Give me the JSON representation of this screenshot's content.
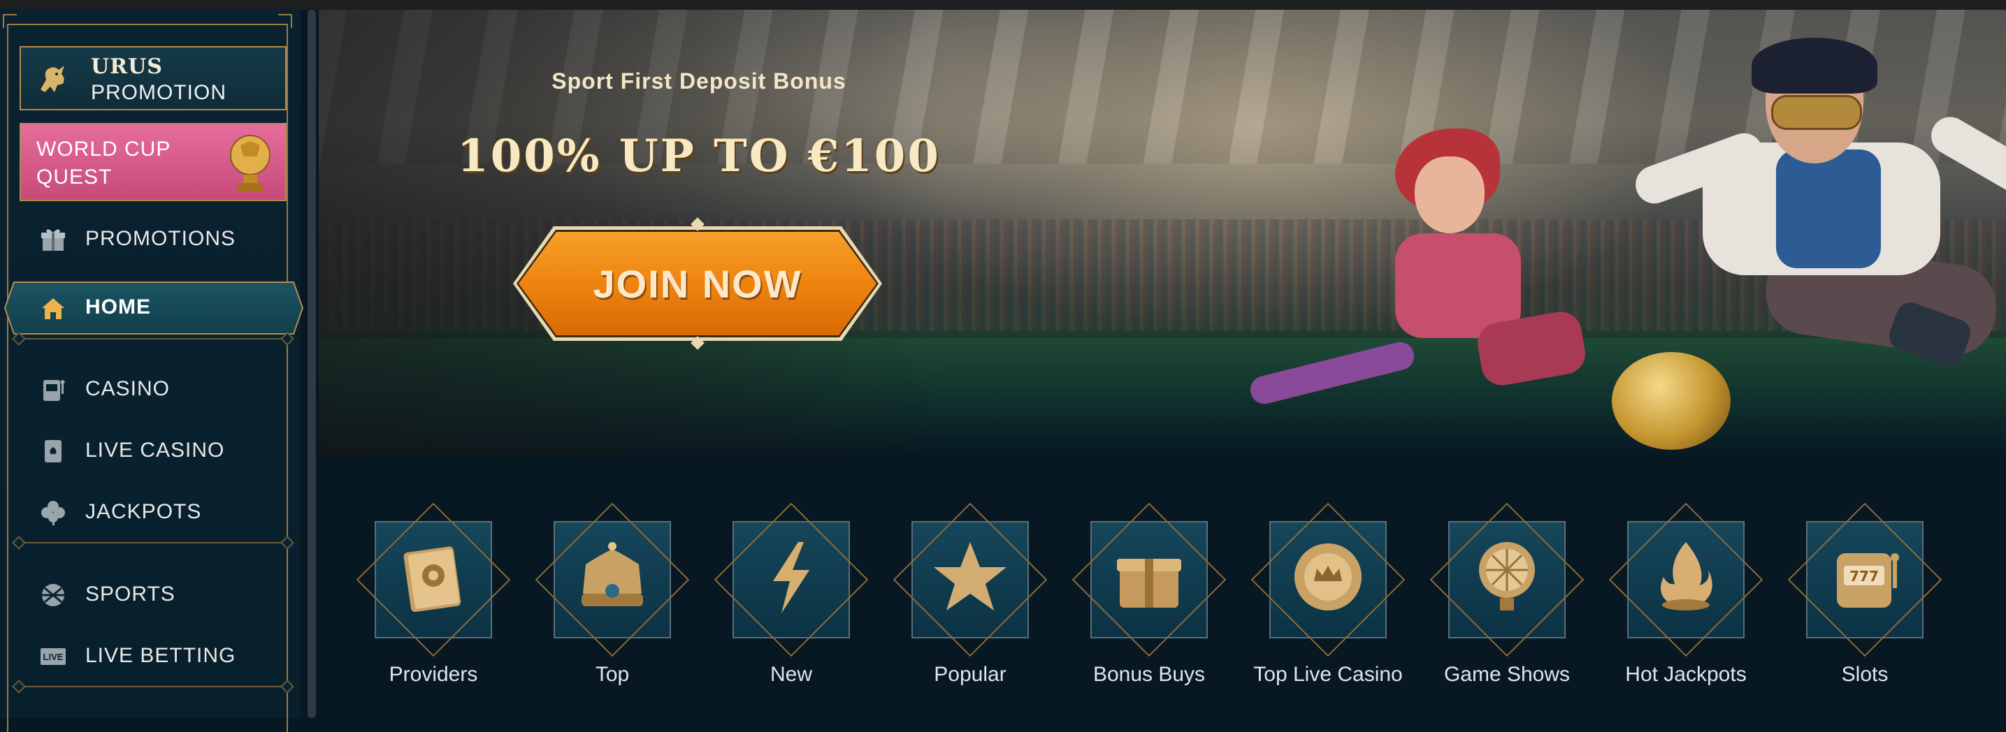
{
  "sidebar": {
    "brand": {
      "title": "URUS",
      "subtitle": "PROMOTION",
      "icon": "bull-icon"
    },
    "quest": {
      "label": "WORLD CUP QUEST",
      "icon": "trophy-ball-icon"
    },
    "items": [
      {
        "label": "PROMOTIONS",
        "icon": "gift-icon"
      },
      {
        "label": "HOME",
        "icon": "home-icon",
        "active": true
      },
      {
        "label": "CASINO",
        "icon": "slot-machine-icon"
      },
      {
        "label": "LIVE CASINO",
        "icon": "playing-card-icon"
      },
      {
        "label": "JACKPOTS",
        "icon": "clover-icon"
      },
      {
        "label": "SPORTS",
        "icon": "ball-icon"
      },
      {
        "label": "LIVE BETTING",
        "icon": "live-badge-icon"
      }
    ]
  },
  "banner": {
    "subtitle": "Sport First Deposit Bonus",
    "headline": "100% UP TO €100",
    "cta": "JOIN NOW"
  },
  "categories": [
    {
      "label": "Providers",
      "icon": "book-gear-icon"
    },
    {
      "label": "Top",
      "icon": "crown-icon"
    },
    {
      "label": "New",
      "icon": "lightning-icon"
    },
    {
      "label": "Popular",
      "icon": "star-icon"
    },
    {
      "label": "Bonus Buys",
      "icon": "gift-box-icon"
    },
    {
      "label": "Top Live Casino",
      "icon": "chip-crown-icon"
    },
    {
      "label": "Game Shows",
      "icon": "wheel-icon"
    },
    {
      "label": "Hot Jackpots",
      "icon": "flame-icon"
    },
    {
      "label": "Slots",
      "icon": "slot-777-icon"
    }
  ],
  "colors": {
    "background": "#071822",
    "gold": "#b48b4c",
    "cta_orange": "#ee8410",
    "quest_pink": "#e66d9d",
    "active_teal": "#1b5563"
  }
}
